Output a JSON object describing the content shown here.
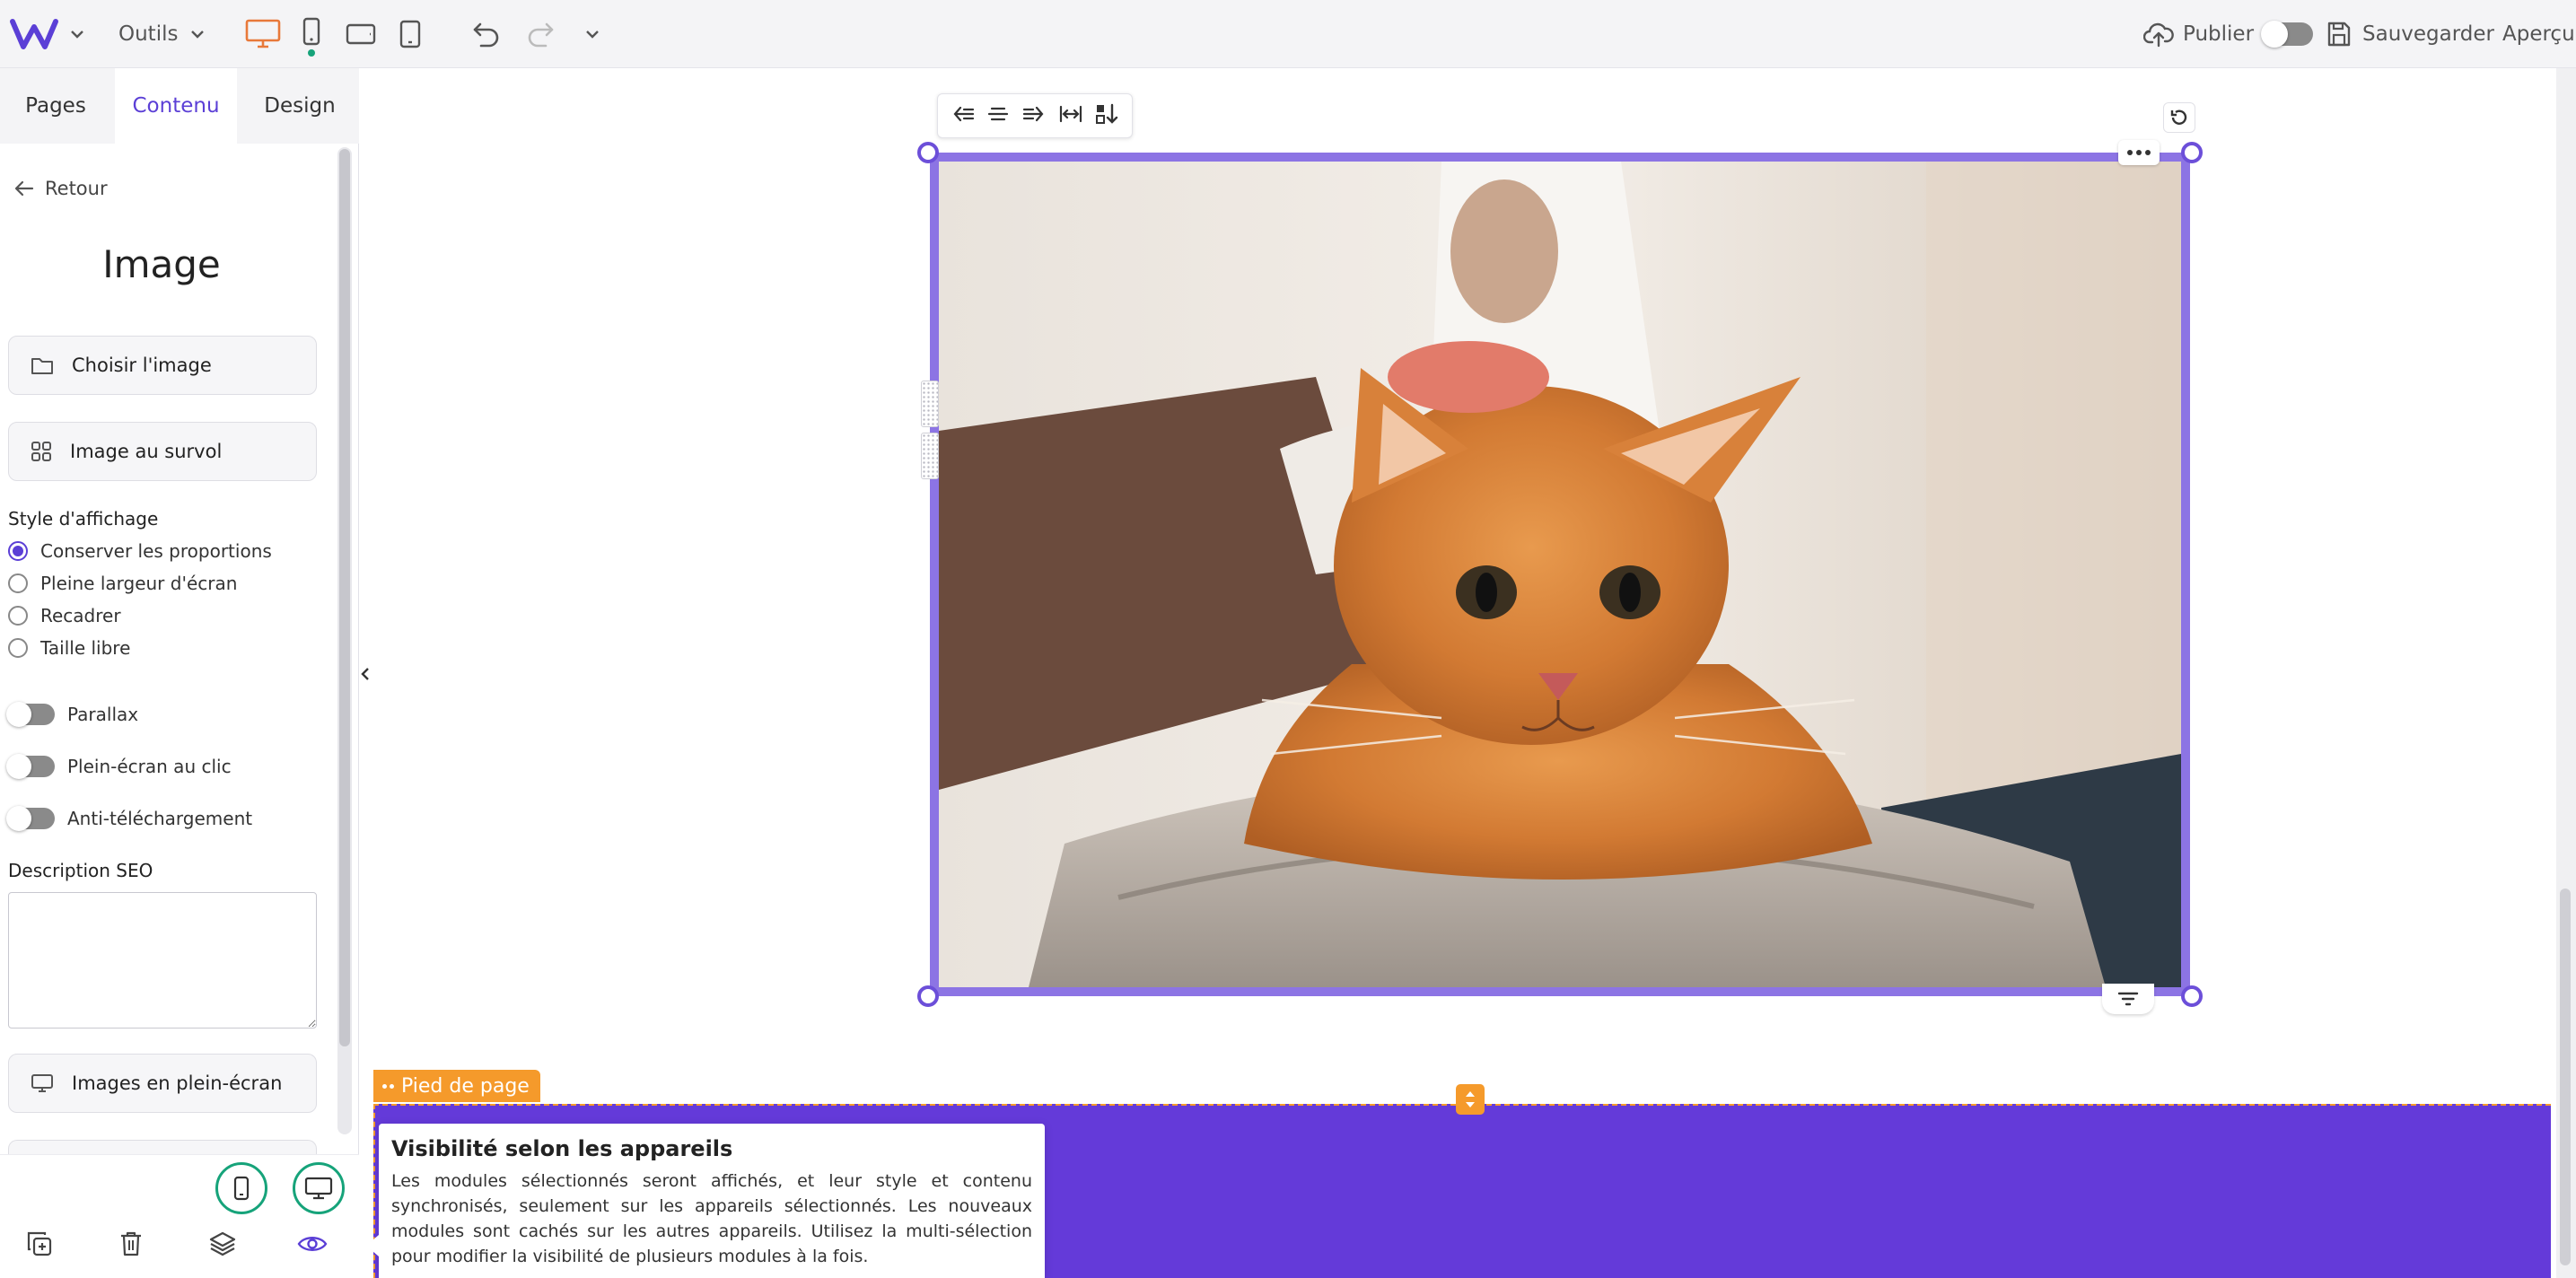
{
  "topbar": {
    "tools_label": "Outils",
    "publish_label": "Publier",
    "save_label": "Sauvegarder",
    "preview_label": "Aperçu"
  },
  "panel": {
    "tabs": [
      {
        "label": "Pages"
      },
      {
        "label": "Contenu"
      },
      {
        "label": "Design"
      }
    ],
    "back_label": "Retour",
    "title": "Image",
    "choose_image_label": "Choisir l'image",
    "hover_image_label": "Image au survol",
    "display_style": {
      "label": "Style d'affichage",
      "options": [
        {
          "label": "Conserver les proportions",
          "selected": true
        },
        {
          "label": "Pleine largeur d'écran",
          "selected": false
        },
        {
          "label": "Recadrer",
          "selected": false
        },
        {
          "label": "Taille libre",
          "selected": false
        }
      ]
    },
    "toggles": [
      {
        "label": "Parallax",
        "on": false
      },
      {
        "label": "Plein-écran au clic",
        "on": false
      },
      {
        "label": "Anti-téléchargement",
        "on": false
      }
    ],
    "seo": {
      "label": "Description SEO",
      "value": ""
    },
    "fullscreen_images_label": "Images en plein-écran"
  },
  "canvas": {
    "footer_label": "Pied de page"
  },
  "tooltip": {
    "title": "Visibilité selon les appareils",
    "text": "Les modules sélectionnés seront affichés, et leur style et contenu synchronisés, seulement sur les appareils sélectionnés. Les nouveaux modules sont cachés sur les autres appareils. Utilisez la multi-sélection pour modifier la visibilité de plusieurs modules à la fois."
  },
  "colors": {
    "accent": "#5b3fd6",
    "selection": "#8c74e4",
    "footer": "#643ad9",
    "footer_tag": "#f59a2b",
    "active_device": "#e8793a",
    "device_ok": "#16a37a"
  },
  "icons": [
    "logo-w",
    "chevron-down-icon",
    "desktop-icon",
    "mobile-icon",
    "tablet-landscape-icon",
    "tablet-icon",
    "undo-icon",
    "redo-icon",
    "upload-cloud-icon",
    "save-icon",
    "arrow-left-icon",
    "folder-icon",
    "grid-icon",
    "monitor-icon",
    "duplicate-icon",
    "trash-icon",
    "layers-icon",
    "eye-icon",
    "align-left-icon",
    "align-center-icon",
    "align-right-icon",
    "fit-width-icon",
    "sort-icon",
    "reset-icon",
    "more-icon",
    "filter-icon"
  ]
}
